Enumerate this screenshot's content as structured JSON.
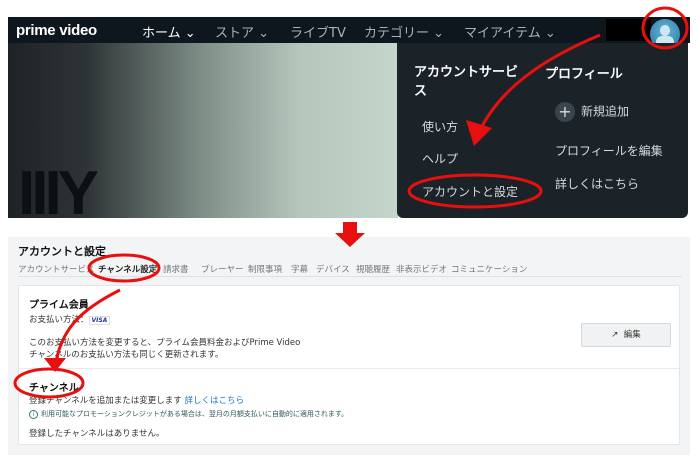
{
  "nav": {
    "logo": "prime video",
    "items": [
      {
        "label": "ホーム ⌄"
      },
      {
        "label": "ストア ⌄"
      },
      {
        "label": "ライブTV"
      },
      {
        "label": "カテゴリー ⌄"
      },
      {
        "label": "マイアイテム ⌄"
      }
    ]
  },
  "hero": {
    "text": "IIIY"
  },
  "dropdown": {
    "account_header_line1": "アカウントサービ",
    "account_header_line2": "ス",
    "profile_header": "プロフィール",
    "links": [
      "使い方",
      "ヘルプ",
      "アカウントと設定"
    ],
    "add_profile": "新規追加",
    "plus": "+",
    "edit_profile": "プロフィールを編集",
    "learn_more": "詳しくはこちら"
  },
  "settings": {
    "title": "アカウントと設定",
    "tabs": [
      "アカウントサービス",
      "チャンネル設定",
      "請求書",
      "プレーヤー",
      "制限事項",
      "字幕",
      "デバイス",
      "視聴履歴",
      "非表示ビデオ",
      "コミュニケーション"
    ],
    "prime": {
      "heading": "プライム会員",
      "payment_label": "お支払い方法：",
      "card_brand": "VISA",
      "note_line1": "このお支払い方法を変更すると、プライム会員料金およびPrime Video",
      "note_line2": "チャンネルのお支払い方法も同じく更新されます。",
      "edit_label": "編集"
    },
    "channels": {
      "heading": "チャンネル",
      "desc": "登録チャンネルを追加または変更します",
      "link": "詳しくはこちら",
      "info": "利用可能なプロモーションクレジットがある場合は、翌月の月額支払いに自動的に適用されます。",
      "empty": "登録したチャンネルはありません。"
    }
  },
  "colors": {
    "annotation": "#e8100f",
    "nav_bg": "#0f171e",
    "link": "#1a73c8"
  }
}
